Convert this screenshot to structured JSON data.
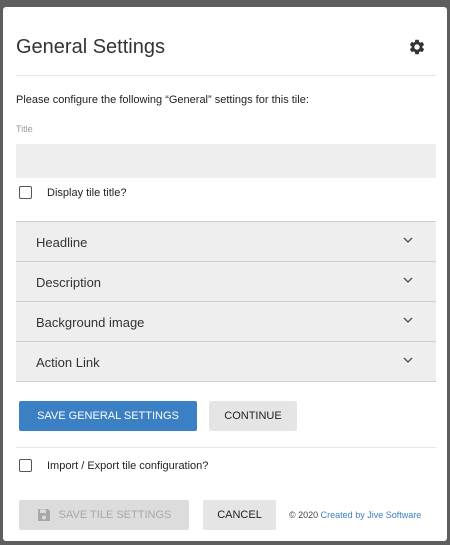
{
  "dialog": {
    "title": "General Settings",
    "intro": "Please configure the following “General” settings for this tile:",
    "title_field": {
      "label": "Title",
      "value": "",
      "placeholder": ""
    },
    "display_title_checkbox": {
      "label": "Display tile title?",
      "checked": false
    },
    "accordion": [
      {
        "label": "Headline"
      },
      {
        "label": "Description"
      },
      {
        "label": "Background image"
      },
      {
        "label": "Action Link"
      }
    ],
    "save_general_label": "SAVE GENERAL SETTINGS",
    "continue_label": "CONTINUE",
    "import_export_checkbox": {
      "label": "Import / Export tile configuration?",
      "checked": false
    },
    "save_tile_label": "SAVE TILE SETTINGS",
    "cancel_label": "CANCEL",
    "footer": {
      "copyright": "© 2020",
      "link_text": "Created by Jive Software"
    }
  },
  "icons": {
    "settings": "gear-icon",
    "expand": "chevron-down-icon",
    "save": "floppy-disk-icon"
  },
  "colors": {
    "primary": "#3b7fc4",
    "overlay": "#5e5e5e",
    "panel": "#eeeeee"
  }
}
